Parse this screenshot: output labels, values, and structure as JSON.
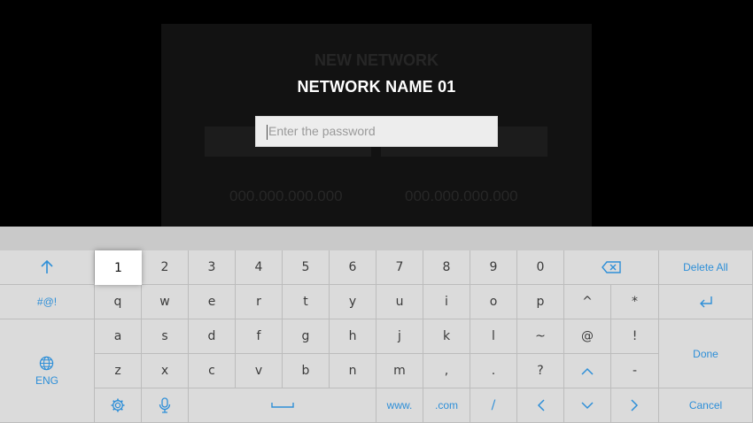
{
  "dialog": {
    "title": "NETWORK NAME 01",
    "password_placeholder": "Enter the password"
  },
  "background_ghost": {
    "title": "NEW NETWORK",
    "ip_left": "000.000.000.000",
    "ip_right": "000.000.000.000"
  },
  "keyboard": {
    "rows": {
      "numbers": [
        "1",
        "2",
        "3",
        "4",
        "5",
        "6",
        "7",
        "8",
        "9",
        "0"
      ],
      "row1": [
        "q",
        "w",
        "e",
        "r",
        "t",
        "y",
        "u",
        "i",
        "o",
        "p",
        "^",
        "*"
      ],
      "row2": [
        "a",
        "s",
        "d",
        "f",
        "g",
        "h",
        "j",
        "k",
        "l",
        "~",
        "@",
        "!"
      ],
      "row3": [
        "z",
        "x",
        "c",
        "v",
        "b",
        "n",
        "m",
        ",",
        ".",
        "?",
        "-"
      ]
    },
    "special": {
      "symbols_label": "#@!",
      "language_label": "ENG",
      "delete_all_label": "Delete All",
      "done_label": "Done",
      "cancel_label": "Cancel",
      "www_label": "www.",
      "com_label": ".com",
      "slash_label": "/"
    },
    "selected_key": "1",
    "colors": {
      "accent": "#2e8fd8",
      "key_bg": "#dbdbdb",
      "selected_bg": "#ffffff"
    }
  }
}
